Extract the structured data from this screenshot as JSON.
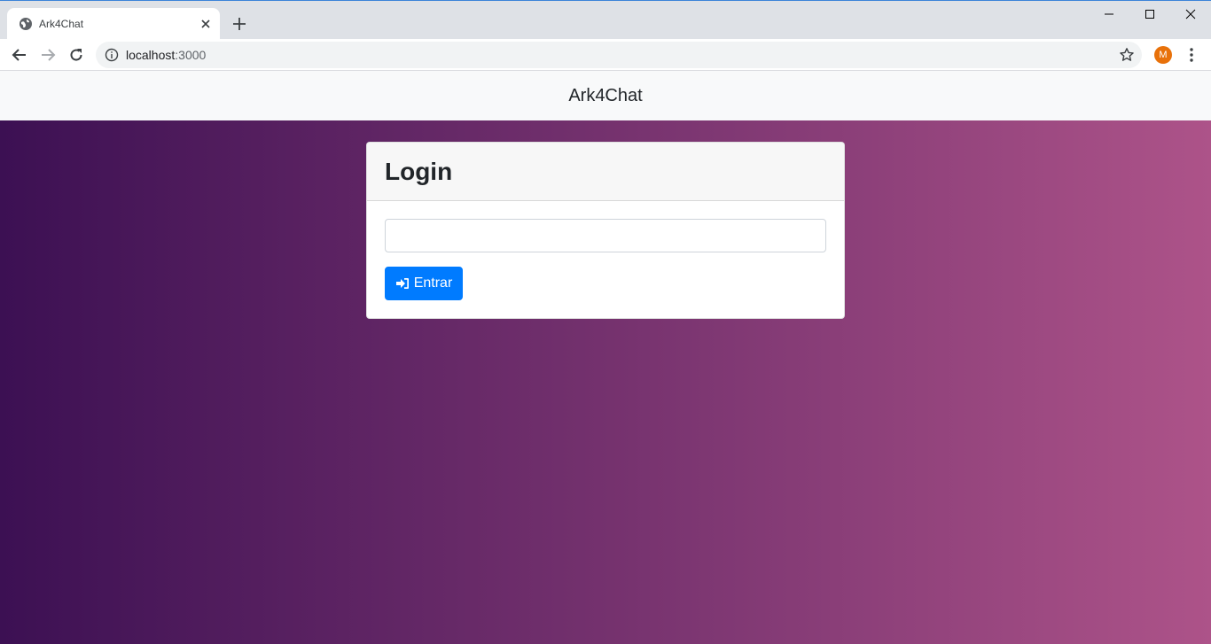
{
  "browser": {
    "tab_title": "Ark4Chat",
    "url_host": "localhost",
    "url_port": ":3000",
    "profile_initial": "M",
    "accent_color": "#007bff"
  },
  "navbar": {
    "brand": "Ark4Chat"
  },
  "login": {
    "title": "Login",
    "input_value": "",
    "button_label": "Entrar"
  },
  "theme": {
    "gradient_start": "#3c1053",
    "gradient_end": "#ad5389",
    "button_color": "#007bff"
  },
  "icons": {
    "tab": "globe-icon",
    "button": "sign-in-icon"
  }
}
